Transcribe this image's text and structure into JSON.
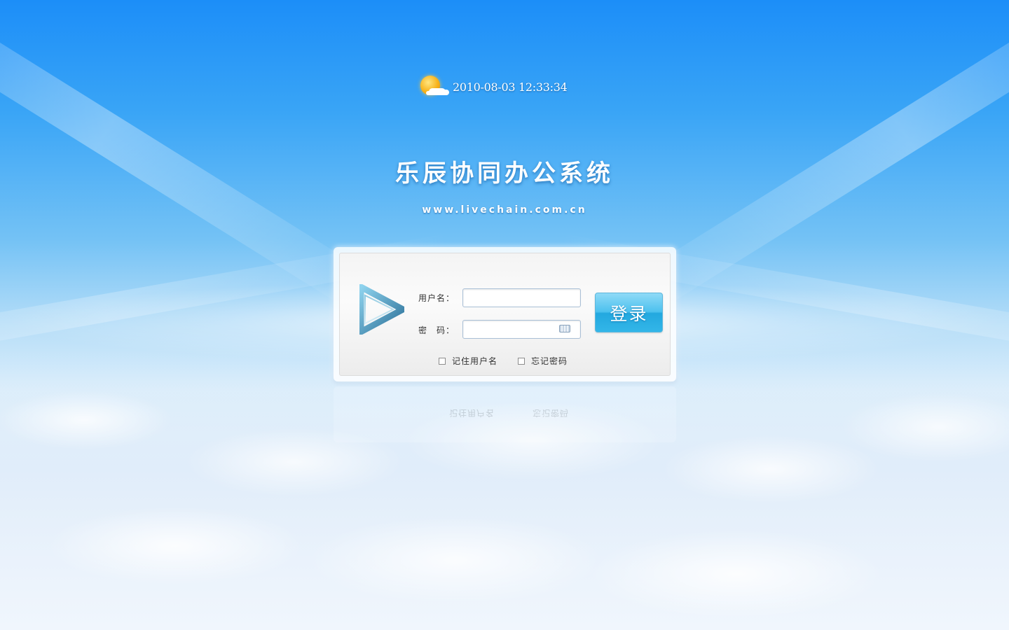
{
  "header": {
    "datetime": "2010-08-03 12:33:34",
    "weather_icon": "sun-cloud-icon"
  },
  "title": "乐辰协同办公系统",
  "site_url": "www.livechain.com.cn",
  "login": {
    "username_label": "用户名：",
    "password_label": "密　码：",
    "username_value": "",
    "password_value": "",
    "keyboard_icon": "keyboard-icon",
    "submit_label": "登录",
    "remember_label": "记住用户名",
    "forgot_label": "忘记密码"
  },
  "colors": {
    "sky_top": "#1c8ef8",
    "button_blue": "#33b6e8",
    "text_dark": "#333333"
  }
}
